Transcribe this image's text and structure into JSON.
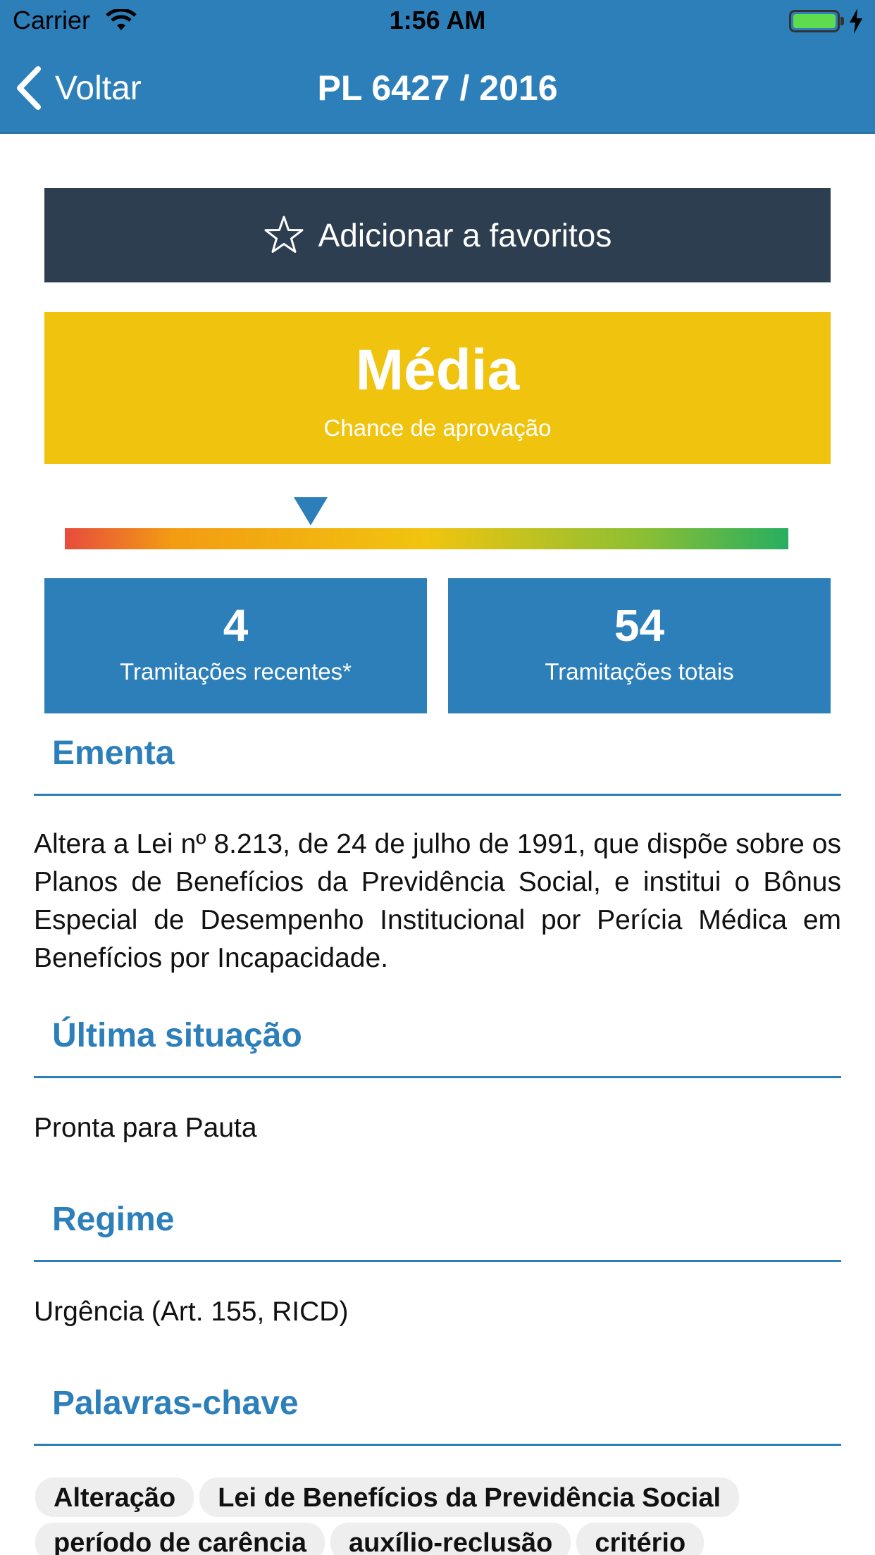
{
  "status_bar": {
    "carrier": "Carrier",
    "time": "1:56 AM"
  },
  "nav": {
    "back_label": "Voltar",
    "title": "PL 6427 / 2016"
  },
  "favorite": {
    "label": "Adicionar a favoritos"
  },
  "chance": {
    "value": "Média",
    "label": "Chance de aprovação",
    "scale_position_percent": 34
  },
  "stats": [
    {
      "value": "4",
      "label": "Tramitações recentes*"
    },
    {
      "value": "54",
      "label": "Tramitações totais"
    }
  ],
  "ementa": {
    "title": "Ementa",
    "text": "Altera a Lei nº 8.213, de 24 de julho de 1991, que dispõe sobre os Planos de Benefícios da Previdência Social, e institui o Bônus Especial de Desempenho Institucional por Perícia Médica em Benefícios por Incapacidade."
  },
  "situacao": {
    "title": "Última situação",
    "text": "Pronta para Pauta"
  },
  "regime": {
    "title": "Regime",
    "text": "Urgência (Art. 155, RICD)"
  },
  "palavras": {
    "title": "Palavras-chave",
    "tags": [
      "Alteração",
      "Lei de Benefícios da Previdência Social",
      "período de carência",
      "auxílio-reclusão",
      "critério"
    ]
  },
  "colors": {
    "primary": "#2d7fba",
    "dark": "#2c3e50",
    "chance": "#f0c30f"
  }
}
